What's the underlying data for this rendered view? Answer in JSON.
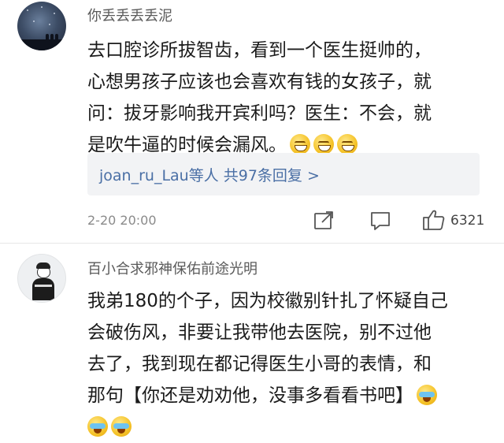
{
  "comments": [
    {
      "username": "你丢丢丢丢泥",
      "text_line_1": "去口腔诊所拔智齿，看到一个医生挺帅的，",
      "text_line_2": "心想男孩子应该也会喜欢有钱的女孩子，就",
      "text_line_3": "问：拔牙影响我开宾利吗？医生：不会，就",
      "text_line_4": "是吹牛逼的时候会漏风。",
      "emoji": [
        "grin-emoji",
        "grin-emoji",
        "grin-emoji"
      ],
      "reply_name": "joan_ru_Lau",
      "reply_summary": "等人  共97条回复 >",
      "date": "2-20 20:00",
      "like_count": "6321",
      "icons": [
        "share-icon",
        "comment-icon",
        "like-icon"
      ]
    },
    {
      "username": "百小合求邪神保佑前途光明",
      "text_line_1": "我弟180的个子，因为校徽别针扎了怀疑自己",
      "text_line_2": "会破伤风，非要让我带他去医院，别不过他",
      "text_line_3": "去了，我到现在都记得医生小哥的表情，和",
      "text_line_4": "那句【你还是劝劝他，没事多看看书吧】",
      "emoji": [
        "cry-laugh-emoji",
        "cry-laugh-emoji",
        "cry-laugh-emoji"
      ]
    }
  ],
  "colors": {
    "link": "#4a6fa5",
    "reply_background": "#f2f3f5",
    "username": "#5a5a5a",
    "meta": "#8a8a8a"
  }
}
